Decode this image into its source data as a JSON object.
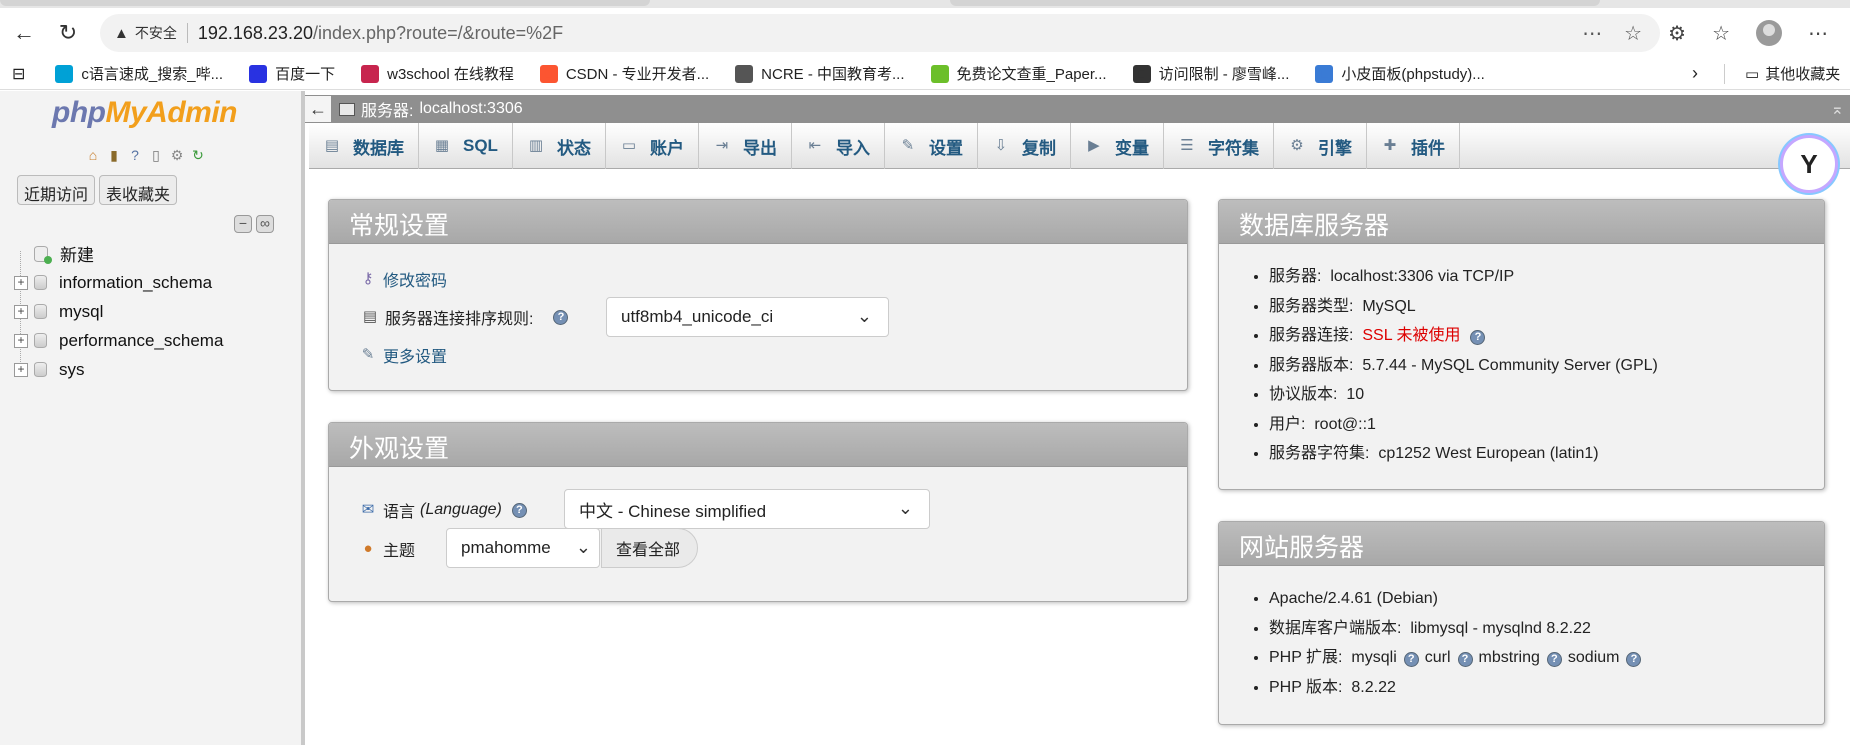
{
  "browser": {
    "security_label": "不安全",
    "url_host": "192.168.23.20",
    "url_path": "/index.php?route=/&route=%2F",
    "bookmarks": [
      {
        "label": "c语言速成_搜索_哔...",
        "color": "#00a1d6",
        "icon": "tv-icon"
      },
      {
        "label": "百度一下",
        "color": "#2932e1",
        "icon": "paw-icon"
      },
      {
        "label": "w3school 在线教程",
        "color": "#c7254e",
        "icon": "w3-icon"
      },
      {
        "label": "CSDN - 专业开发者...",
        "color": "#fc5531",
        "icon": "csdn-icon"
      },
      {
        "label": "NCRE - 中国教育考...",
        "color": "#555555",
        "icon": "globe-icon"
      },
      {
        "label": "免费论文查重_Paper...",
        "color": "#6cbf2a",
        "icon": "leaf-icon"
      },
      {
        "label": "访问限制 - 廖雪峰...",
        "color": "#333333",
        "icon": "pen-icon"
      },
      {
        "label": "小皮面板(phpstudy)...",
        "color": "#3a7bd5",
        "icon": "panel-icon"
      }
    ],
    "other_bookmarks": "其他收藏夹"
  },
  "sidebar": {
    "logo_php": "php",
    "logo_myadmin": "MyAdmin",
    "recent_btn": "近期访问",
    "favorites_btn": "表收藏夹",
    "new_label": "新建",
    "databases": [
      "information_schema",
      "mysql",
      "performance_schema",
      "sys"
    ]
  },
  "topbar": {
    "server_label": "服务器:",
    "server_value": "localhost:3306"
  },
  "menu": [
    {
      "label": "数据库",
      "icon": "database-icon",
      "glyph": "▤"
    },
    {
      "label": "SQL",
      "icon": "sql-icon",
      "glyph": "▦"
    },
    {
      "label": "状态",
      "icon": "status-icon",
      "glyph": "▥"
    },
    {
      "label": "账户",
      "icon": "accounts-icon",
      "glyph": "▭"
    },
    {
      "label": "导出",
      "icon": "export-icon",
      "glyph": "⇥"
    },
    {
      "label": "导入",
      "icon": "import-icon",
      "glyph": "⇤"
    },
    {
      "label": "设置",
      "icon": "wrench-icon",
      "glyph": "✎"
    },
    {
      "label": "复制",
      "icon": "replication-icon",
      "glyph": "⇩"
    },
    {
      "label": "变量",
      "icon": "variables-icon",
      "glyph": "▶"
    },
    {
      "label": "字符集",
      "icon": "charset-icon",
      "glyph": "☰"
    },
    {
      "label": "引擎",
      "icon": "engine-icon",
      "glyph": "⚙"
    },
    {
      "label": "插件",
      "icon": "plugin-icon",
      "glyph": "✚"
    }
  ],
  "general": {
    "title": "常规设置",
    "change_password": "修改密码",
    "collation_label": "服务器连接排序规则:",
    "collation_value": "utf8mb4_unicode_ci",
    "more_settings": "更多设置"
  },
  "appearance": {
    "title": "外观设置",
    "language_label": "语言",
    "language_en": "(Language)",
    "language_value": "中文 - Chinese simplified",
    "theme_label": "主题",
    "theme_value": "pmahomme",
    "view_all": "查看全部"
  },
  "db_server": {
    "title": "数据库服务器",
    "items": [
      {
        "label": "服务器:",
        "value": "localhost:3306 via TCP/IP"
      },
      {
        "label": "服务器类型:",
        "value": "MySQL"
      },
      {
        "label": "服务器连接:",
        "value": "SSL 未被使用"
      },
      {
        "label": "服务器版本:",
        "value": "5.7.44 - MySQL Community Server (GPL)"
      },
      {
        "label": "协议版本:",
        "value": "10"
      },
      {
        "label": "用户:",
        "value": "root@::1"
      },
      {
        "label": "服务器字符集:",
        "value": "cp1252 West European (latin1)"
      }
    ]
  },
  "web_server": {
    "title": "网站服务器",
    "apache": "Apache/2.4.61 (Debian)",
    "client_label": "数据库客户端版本:",
    "client_value": "libmysql - mysqlnd 8.2.22",
    "ext_label": "PHP 扩展:",
    "extensions": [
      "mysqli",
      "curl",
      "mbstring",
      "sodium"
    ],
    "php_label": "PHP 版本:",
    "php_value": "8.2.22"
  }
}
